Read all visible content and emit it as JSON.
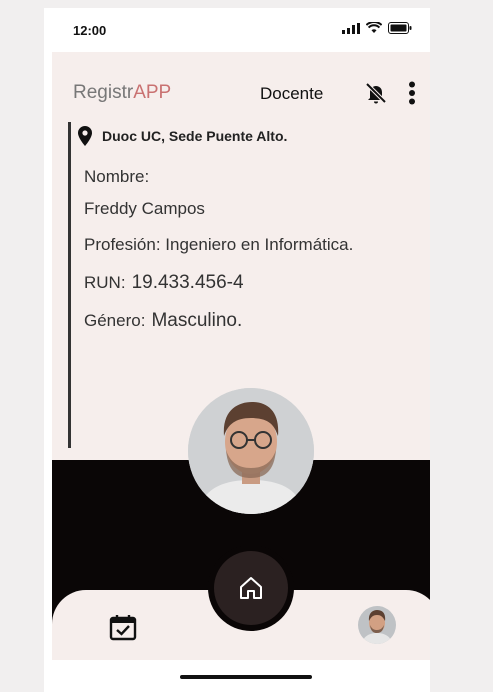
{
  "status_bar": {
    "time": "12:00"
  },
  "header": {
    "brand_prefix": "Registr",
    "brand_accent": "APP",
    "role": "Docente"
  },
  "location": {
    "text": "Duoc UC, Sede Puente Alto."
  },
  "profile": {
    "name_label": "Nombre:",
    "name_value": "Freddy Campos",
    "profession_label": "Profesión:",
    "profession_value": "Ingeniero en Informática.",
    "run_label": "RUN:",
    "run_value": "19.433.456-4",
    "gender_label": "Género:",
    "gender_value": "Masculino."
  },
  "icons": {
    "bell": "bell-off-icon",
    "menu": "more-vertical-icon",
    "location": "map-pin-icon",
    "home": "home-icon",
    "calendar": "calendar-check-icon"
  },
  "colors": {
    "accent": "#c97171",
    "background": "#f6eeec",
    "dark": "#0a0606"
  }
}
